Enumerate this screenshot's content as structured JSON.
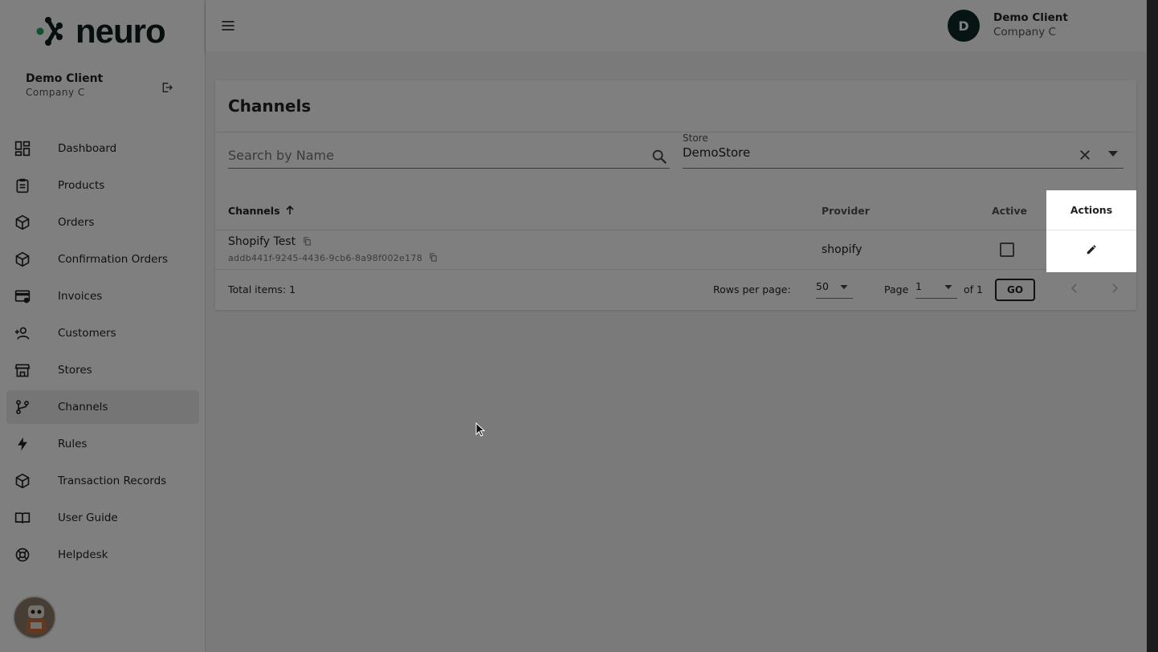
{
  "brand": {
    "logo_text": "neuro",
    "accent": "#1aa35b"
  },
  "sidebar": {
    "user_name": "Demo Client",
    "user_company": "Company C",
    "items": [
      {
        "label": "Dashboard",
        "icon": "dashboard-icon"
      },
      {
        "label": "Products",
        "icon": "clipboard-icon"
      },
      {
        "label": "Orders",
        "icon": "box-icon"
      },
      {
        "label": "Confirmation Orders",
        "icon": "box-icon"
      },
      {
        "label": "Invoices",
        "icon": "invoice-card-icon"
      },
      {
        "label": "Customers",
        "icon": "add-user-icon"
      },
      {
        "label": "Stores",
        "icon": "store-icon"
      },
      {
        "label": "Channels",
        "icon": "fork-icon",
        "active": true
      },
      {
        "label": "Rules",
        "icon": "bolt-icon"
      },
      {
        "label": "Transaction Records",
        "icon": "box-icon"
      },
      {
        "label": "User Guide",
        "icon": "book-icon"
      },
      {
        "label": "Helpdesk",
        "icon": "lifebuoy-icon"
      }
    ]
  },
  "topbar": {
    "avatar_initial": "D",
    "user_name": "Demo Client",
    "user_company": "Company C"
  },
  "page": {
    "title": "Channels",
    "search_placeholder": "Search by Name",
    "store_label": "Store",
    "store_value": "DemoStore"
  },
  "table": {
    "columns": {
      "channels": "Channels",
      "provider": "Provider",
      "active": "Active",
      "actions": "Actions"
    },
    "rows": [
      {
        "name": "Shopify Test",
        "id": "addb441f-9245-4436-9cb6-8a98f002e178",
        "provider": "shopify",
        "active": false
      }
    ]
  },
  "pagination": {
    "total": "Total items: 1",
    "rows_per_page_label": "Rows per page:",
    "rows_per_page": "50",
    "page_label": "Page",
    "page": "1",
    "of_label": "of 1",
    "go_label": "GO"
  }
}
